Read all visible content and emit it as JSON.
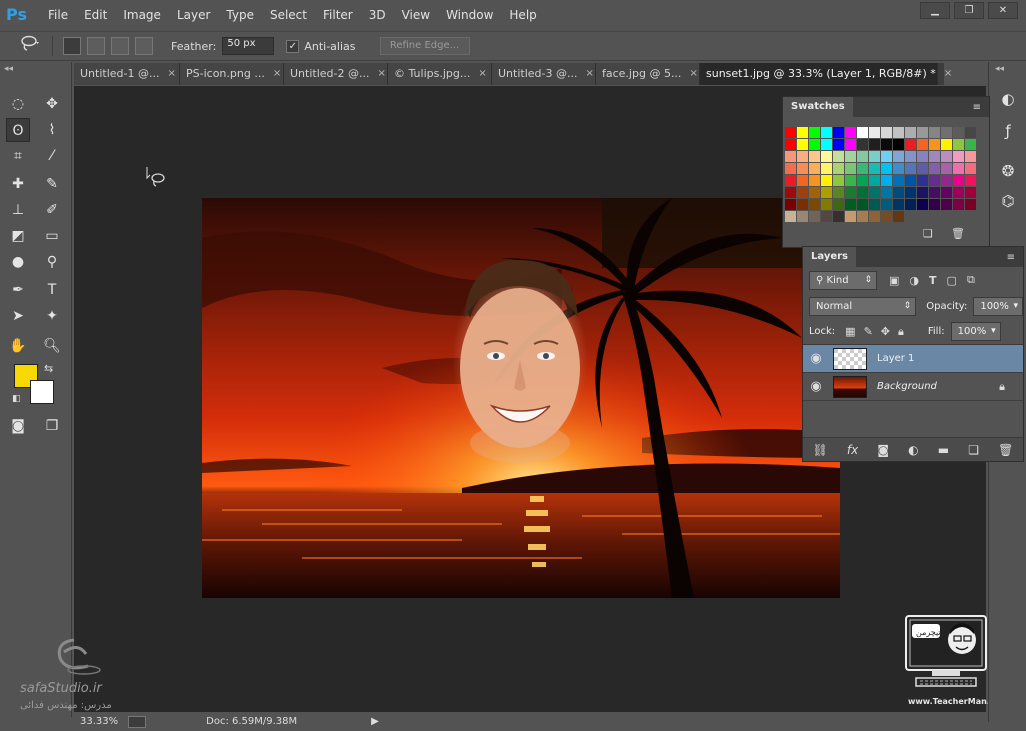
{
  "app": {
    "logo": "Ps"
  },
  "menu": [
    "File",
    "Edit",
    "Image",
    "Layer",
    "Type",
    "Select",
    "Filter",
    "3D",
    "View",
    "Window",
    "Help"
  ],
  "window_controls": {
    "minimize": "▁",
    "restore": "❐",
    "close": "✕"
  },
  "options": {
    "feather_label": "Feather:",
    "feather_value": "50 px",
    "antialias_label": "Anti-alias",
    "antialias_checked": "✓",
    "refine_label": "Refine Edge..."
  },
  "tabs": [
    {
      "label": "Untitled-1 @...",
      "close": "×"
    },
    {
      "label": "PS-icon.png ...",
      "close": "×"
    },
    {
      "label": "Untitled-2 @...",
      "close": "×"
    },
    {
      "label": "© Tulips.jpg...",
      "close": "×"
    },
    {
      "label": "Untitled-3 @...",
      "close": "×"
    },
    {
      "label": "face.jpg @ 5...",
      "close": "×"
    },
    {
      "label": "sunset1.jpg @ 33.3% (Layer 1, RGB/8#) *",
      "close": "×"
    }
  ],
  "colors": {
    "foreground": "#f7d800",
    "background": "#ffffff",
    "accent": "#2fa0e8",
    "selected_layer": "#6b87a6"
  },
  "swatches": {
    "title": "Swatches",
    "colors": [
      "#ff0000",
      "#ffff00",
      "#00ff00",
      "#00ffff",
      "#0000ff",
      "#ff00ff",
      "#ffffff",
      "#ebebeb",
      "#d6d6d6",
      "#c2c2c2",
      "#adadad",
      "#999999",
      "#858585",
      "#707070",
      "#5c5c5c",
      "#474747",
      "#ff0000",
      "#ffff00",
      "#00ff00",
      "#00ffff",
      "#0000ff",
      "#ff00ff",
      "#333333",
      "#1f1f1f",
      "#0a0a0a",
      "#000000",
      "#ec1c24",
      "#f26522",
      "#f7941d",
      "#fff200",
      "#8dc63f",
      "#39b54a",
      "#f7977a",
      "#f9ad81",
      "#fdc68a",
      "#fff79a",
      "#c4df9b",
      "#a2d39c",
      "#82ca9d",
      "#7bcdc8",
      "#6ecff6",
      "#7ea7d8",
      "#8493ca",
      "#8882be",
      "#a187be",
      "#bc8dbf",
      "#f49ac2",
      "#f6989d",
      "#f26c4f",
      "#f68e55",
      "#fbaf5c",
      "#fff467",
      "#acd372",
      "#7cc576",
      "#3bb878",
      "#1abbb4",
      "#00bff3",
      "#438ccb",
      "#5574b9",
      "#605ca8",
      "#855fa8",
      "#a763a8",
      "#f06ea9",
      "#f26d7d",
      "#ed1c24",
      "#f26522",
      "#f7941d",
      "#fff200",
      "#8dc63f",
      "#39b54a",
      "#00a651",
      "#00a99d",
      "#00aeef",
      "#0072bc",
      "#0054a6",
      "#2e3192",
      "#662d91",
      "#92278f",
      "#ec008c",
      "#ed145b",
      "#9e0b0f",
      "#a0410d",
      "#a36209",
      "#aba000",
      "#598527",
      "#1a7b30",
      "#007236",
      "#00746b",
      "#0076a3",
      "#004b80",
      "#003471",
      "#1b1464",
      "#440e62",
      "#630460",
      "#9e005d",
      "#9e0039",
      "#790000",
      "#7b2e00",
      "#7d4900",
      "#827b00",
      "#406618",
      "#005e20",
      "#005826",
      "#005952",
      "#005b7f",
      "#003663",
      "#002157",
      "#0d004c",
      "#32004b",
      "#4b0049",
      "#7b0046",
      "#7a0026",
      "#c7b299",
      "#998675",
      "#736357",
      "#534741",
      "#362f2d",
      "#c69c6d",
      "#a67c52",
      "#8c6239",
      "#754c24",
      "#603913"
    ]
  },
  "layers": {
    "title": "Layers",
    "kind_label": "Kind",
    "blend_mode": "Normal",
    "opacity_label": "Opacity:",
    "opacity_value": "100%",
    "lock_label": "Lock:",
    "fill_label": "Fill:",
    "fill_value": "100%",
    "items": [
      {
        "name": "Layer 1"
      },
      {
        "name": "Background"
      }
    ]
  },
  "status": {
    "zoom": "33.33%",
    "doc": "Doc: 6.59M/9.38M"
  },
  "watermarks": {
    "left_site": "safaStudio.ir",
    "left_author": "مدرس: مهندس فدائی",
    "right_site": "www.TeacherMan.ir"
  }
}
